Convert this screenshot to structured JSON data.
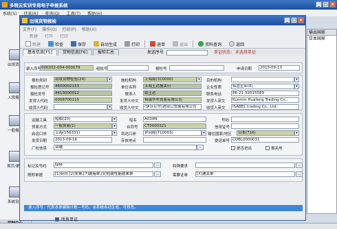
{
  "app": {
    "title": "多税云实训专用电子申报系统",
    "menu": [
      "系统(S)",
      "信息(R)",
      "查询(Q)",
      "工具(T)",
      "帮助(H)"
    ]
  },
  "left_toolbar": [
    {
      "label": "出境货物"
    },
    {
      "label": "入境报检"
    },
    {
      "label": "一般报检"
    },
    {
      "label": "首页/更新"
    },
    {
      "label": "系统设置"
    },
    {
      "label": "控制中心"
    }
  ],
  "right_panel": {
    "header": "输出国家",
    "cell": "日本国家"
  },
  "dialog": {
    "title": "出境货物报检",
    "menu": [
      "文件(F)",
      "操作(O)",
      "打印(P)",
      "帮助(H)"
    ],
    "toolbar1": [
      "新建",
      "打开",
      "打印"
    ],
    "toolbar2": [
      "新建",
      "检查",
      "保存",
      "自动生成",
      "打印",
      "退单",
      "退出",
      "资料查询",
      "返回"
    ],
    "tabs": [
      "基本信息[F5]",
      "货物信息[F6]",
      "报检汇总"
    ],
    "send_no_label": "发送序号",
    "status_label": "单证状态：",
    "status_value": "未选择单证",
    "row_entry": {
      "entry_no_label": "录入序号",
      "entry_no": "000202-004-000079",
      "org_no_label": "组批号",
      "report_no_label": "报检号",
      "apply_date_label": "申请日期",
      "apply_date": "2013-09-13"
    },
    "fields": {
      "insp_category_label": "报检类别",
      "insp_category": "出境货物检验(24)",
      "org_label": "施检机构",
      "org": "上海局(310000)",
      "dest_org_label": "目的机构",
      "reg_no_label": "报检登记号",
      "reg_no": "4600002133",
      "unit_name_label": "单位名称",
      "unit_name": "上海王达报关行",
      "enterprise_label": "企业性质",
      "enterprise": "私营企业(6)",
      "applicant_no_label": "报检员号",
      "applicant_no": "4413000012",
      "contact_label": "联系人",
      "contact": "张王达",
      "phone_label": "联系电话",
      "phone": "86-21-32015589",
      "sender_code_label": "发货人代码",
      "sender_code": "0008700115",
      "sender_cn_label": "发货人中文",
      "sender_cn": "恒瑞华丰贸易有限公司",
      "sender_en_label": "发货人英文",
      "sender_en": "Kunmin Huafeng Trading Co.,",
      "receiver_code_label": "收货人代码",
      "receiver_cn_label": "收货人中文",
      "receiver_cn": "(伊莎贝尔)进出口贸易有限公司",
      "receiver_en_label": "收货人英文",
      "receiver_en": "ISABEL trading Co., Ltd.",
      "transport_label": "运输工具",
      "transport": "船舶(20)",
      "ship_name_label": "船名",
      "ship_name": "A034N",
      "number_label": "号码",
      "trade_label": "贸易方式",
      "trade": "一般贸易(1)",
      "contract_label": "合同号",
      "contract": "CT0000321",
      "credit_label": "信用证号",
      "exit_port_label": "启运口岸",
      "exit_port": "上海(156331)",
      "arrive_port_label": "到达口岸",
      "arrive_port": "井冈陵(710003)",
      "dest_country_label": "输往国家/地区",
      "dest_country": "日本(716)",
      "ship_date_label": "发货日期",
      "ship_date": "2013-09-16",
      "storage_label": "存放地点",
      "visa_no_label": "提运单号",
      "visa_no": "COBL0000031",
      "factory_label": "厂检信息",
      "factory": "台端",
      "transit_label": "是否进出",
      "consign_label": "报关地"
    },
    "bottom": {
      "mark_label": "标记及号码",
      "mark": "N/M",
      "special_label": "特殊要求",
      "attached_label": "随附单据",
      "attached": "[1]合同,[2]发票,[7]装箱单,[9]包装性能结果单",
      "needed_label": "需要证单",
      "needed": "[X]通关单"
    },
    "note": "录入序号：代表本单编辑计数—号码，由系统自动生成，可修改。",
    "bottom_check": "所有单证"
  }
}
